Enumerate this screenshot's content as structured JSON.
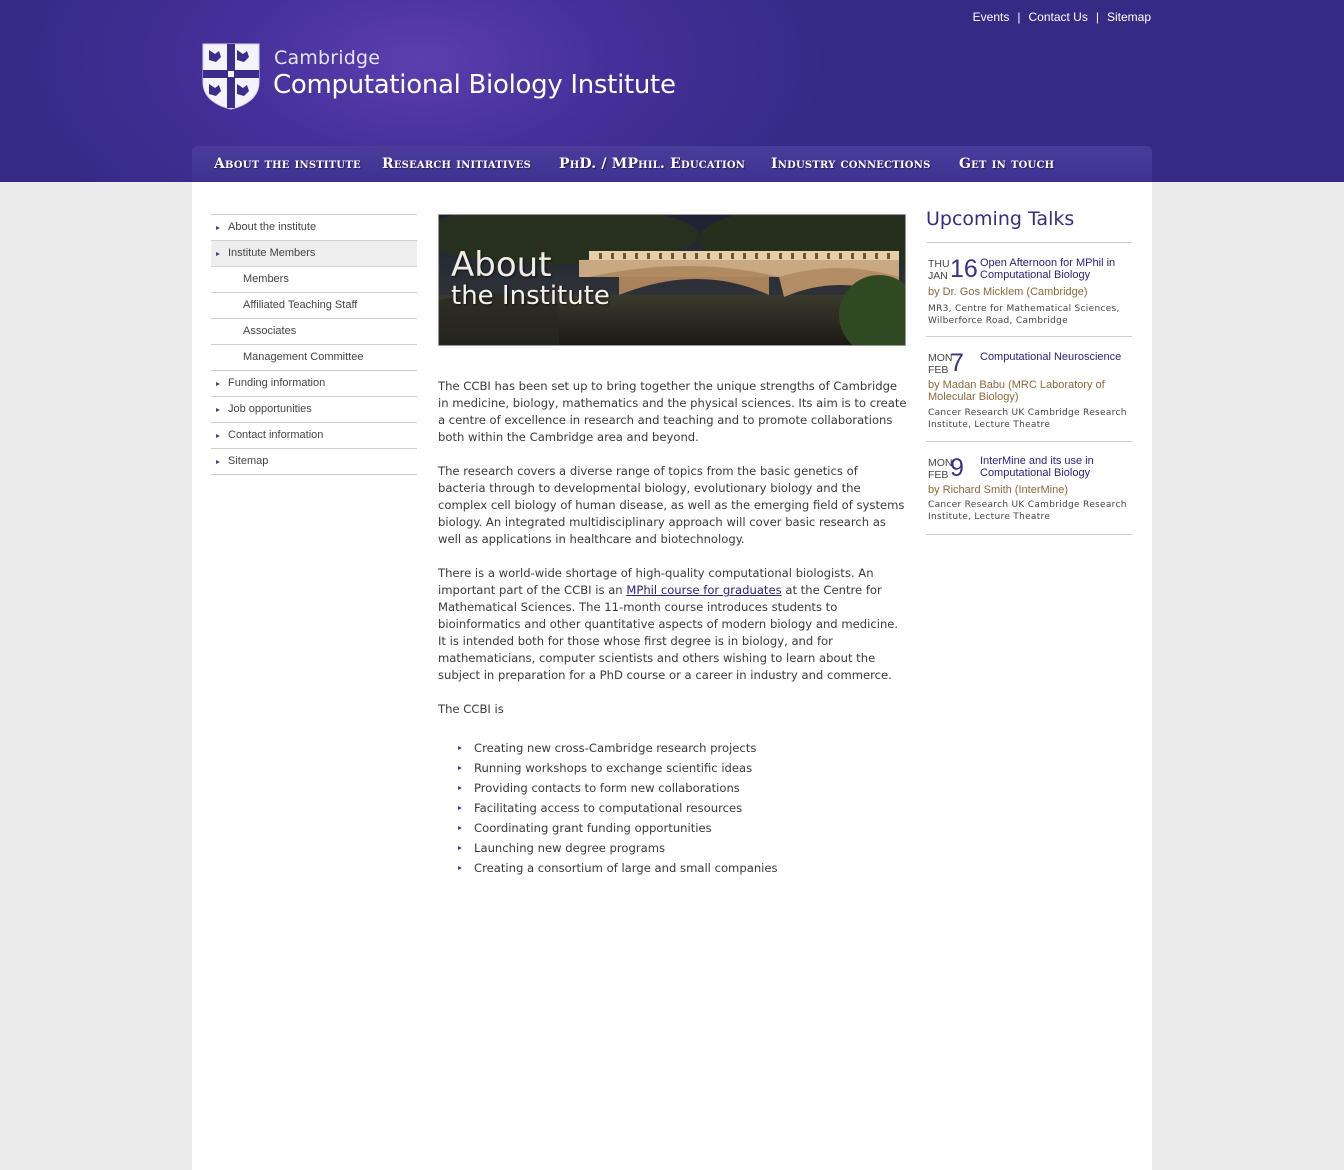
{
  "top_links": [
    "Events",
    "Contact Us",
    "Sitemap"
  ],
  "brand": {
    "line1": "Cambridge",
    "line2": "Computational Biology Institute"
  },
  "nav": [
    "About the institute",
    "Research initiatives",
    "PhD. / MPhil. Education",
    "Industry connections",
    "Get in touch"
  ],
  "sidebar": [
    {
      "label": "About the institute"
    },
    {
      "label": "Institute Members"
    },
    {
      "label": "Members"
    },
    {
      "label": "Affiliated Teaching Staff"
    },
    {
      "label": "Associates"
    },
    {
      "label": "Management Committee"
    },
    {
      "label": "Funding information"
    },
    {
      "label": "Job opportunities"
    },
    {
      "label": "Contact information"
    },
    {
      "label": "Sitemap"
    }
  ],
  "hero": {
    "line1": "About",
    "line2": "the Institute"
  },
  "content": {
    "para1": "The CCBI has been set up to bring together the unique strengths of Cambridge in medicine, biology, mathematics and the physical sciences. Its aim is to create a centre of excellence in research and teaching and to promote collaborations both within the Cambridge area and beyond.",
    "para2": "The research covers a diverse range of topics from the basic genetics of bacteria through to developmental biology, evolutionary biology and the complex cell biology of human disease, as well as the emerging field of systems biology. An integrated multidisciplinary approach will cover basic research as well as applications in healthcare and biotechnology.",
    "para3_before": "There is a world-wide shortage of high-quality computational biologists. An important part of the CCBI is an ",
    "para3_link": "MPhil course for graduates",
    "para3_after": " at the Centre for Mathematical Sciences. The 11-month course introduces students to bioinformatics and other quantitative aspects of modern biology and medicine. It is intended both for those whose first degree is in biology, and for mathematicians, computer scientists and others wishing to learn about the subject in preparation for a PhD course or a career in industry and commerce.",
    "para4": "The CCBI is",
    "bullets": [
      "Creating new cross-Cambridge research projects",
      "Running workshops to exchange scientific ideas",
      "Providing contacts to form new collaborations",
      "Facilitating access to computational resources",
      "Coordinating grant funding opportunities",
      "Launching new degree programs",
      "Creating a consortium of large and small companies"
    ]
  },
  "talks": {
    "heading": "Upcoming Talks",
    "items": [
      {
        "dow": "THU",
        "mon": "JAN",
        "day": "16",
        "title": "Open Afternoon for MPhil in Computational Biology",
        "by": "by Dr. Gos Micklem (Cambridge)",
        "location": "MR3, Centre for Mathematical Sciences, Wilberforce Road, Cambridge"
      },
      {
        "dow": "MON",
        "mon": "FEB",
        "day": "7",
        "title": "Computational Neuroscience",
        "by": "by Madan Babu (MRC Laboratory of Molecular Biology)",
        "location": "Cancer Research UK Cambridge Research Institute, Lecture Theatre"
      },
      {
        "dow": "MON",
        "mon": "FEB",
        "day": "9",
        "title": "InterMine and its use in Computational Biology",
        "by": "by Richard Smith (InterMine)",
        "location": "Cancer Research UK Cambridge Research Institute, Lecture Theatre"
      }
    ]
  }
}
